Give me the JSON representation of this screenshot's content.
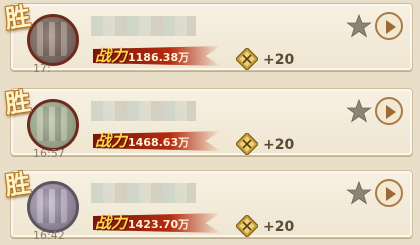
{
  "battle_records": [
    {
      "result": "胜",
      "time": "17:",
      "power_label": "战力",
      "power_value": "1186.38万",
      "reward": "+20",
      "icons": {
        "reward": "crossed-swords-badge-icon",
        "favorite": "star-icon",
        "replay": "play-icon"
      }
    },
    {
      "result": "胜",
      "time": "16:57",
      "power_label": "战力",
      "power_value": "1468.63万",
      "reward": "+20",
      "icons": {
        "reward": "crossed-swords-badge-icon",
        "favorite": "star-icon",
        "replay": "play-icon"
      }
    },
    {
      "result": "胜",
      "time": "16:42",
      "power_label": "战力",
      "power_value": "1423.70万",
      "reward": "+20",
      "icons": {
        "reward": "crossed-swords-badge-icon",
        "favorite": "star-icon",
        "replay": "play-icon"
      }
    }
  ],
  "colors": {
    "background": "#e9dfc9",
    "power_ribbon": "#b52a10",
    "power_label": "#ffd24a",
    "win_badge": "#fff2c4",
    "star": "#8d8275",
    "play_ring": "#a87b4a"
  }
}
